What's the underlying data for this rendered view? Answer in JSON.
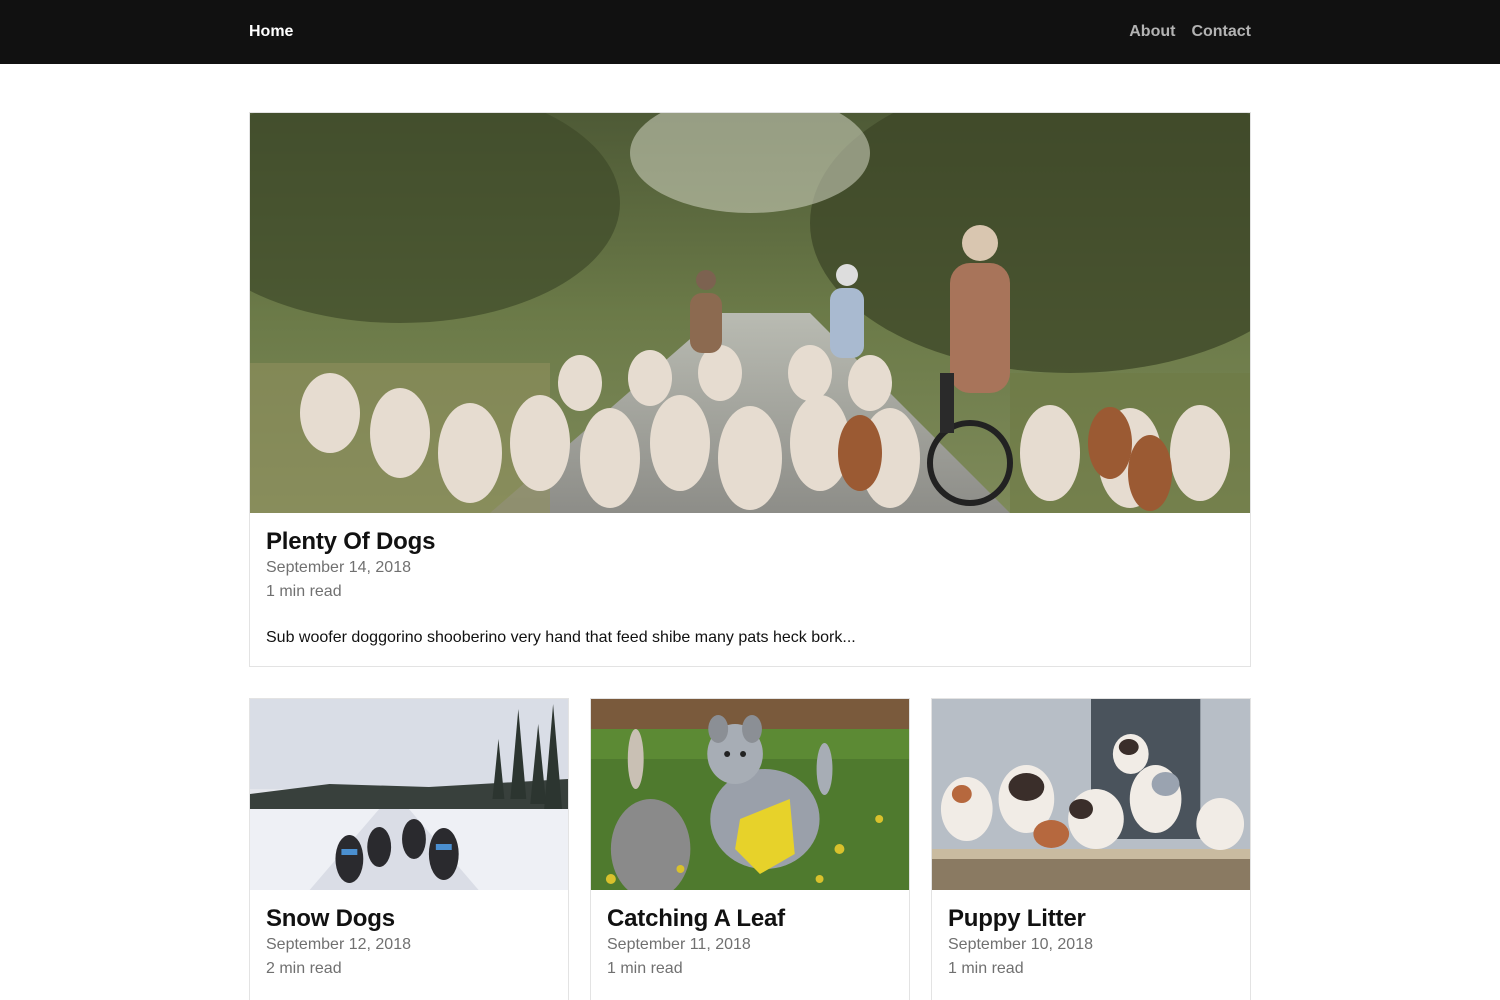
{
  "nav": {
    "home_label": "Home",
    "links": [
      {
        "label": "About"
      },
      {
        "label": "Contact"
      }
    ]
  },
  "featured": {
    "image": "hound-pack-with-cyclists-photo",
    "title": "Plenty Of Dogs",
    "date": "September 14, 2018",
    "readtime": "1 min read",
    "excerpt": "Sub woofer doggorino shooberino very hand that feed shibe many pats heck bork..."
  },
  "posts": [
    {
      "image": "sled-dogs-snow-photo",
      "title": "Snow Dogs",
      "date": "September 12, 2018",
      "readtime": "2 min read"
    },
    {
      "image": "puppy-with-leaf-photo",
      "title": "Catching A Leaf",
      "date": "September 11, 2018",
      "readtime": "1 min read"
    },
    {
      "image": "puppy-litter-photo",
      "title": "Puppy Litter",
      "date": "September 10, 2018",
      "readtime": "1 min read"
    }
  ],
  "colors": {
    "navbar_bg": "#111111",
    "nav_link": "#b3b3b3",
    "meta_text": "#707070",
    "card_border": "#e3e3e3"
  }
}
